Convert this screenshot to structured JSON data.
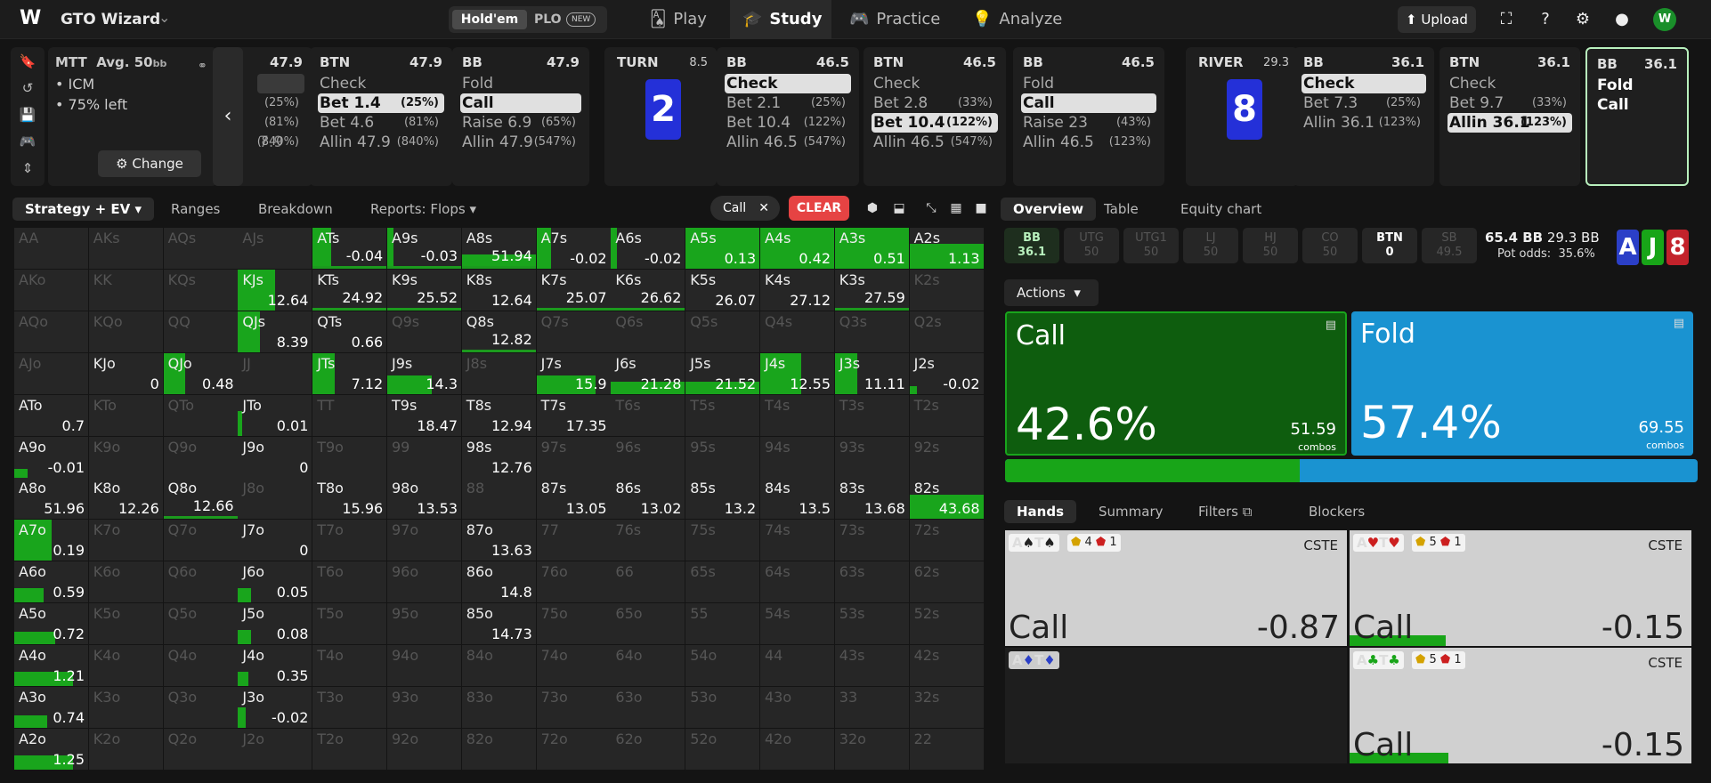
{
  "header": {
    "brand": "GTO Wizard",
    "toggle": {
      "holdem": "Hold'em",
      "plo": "PLO",
      "new_badge": "NEW"
    },
    "nav": [
      {
        "label": "Play",
        "icon": "cards-icon"
      },
      {
        "label": "Study",
        "icon": "graduation-cap-icon"
      },
      {
        "label": "Practice",
        "icon": "gamepad-icon"
      },
      {
        "label": "Analyze",
        "icon": "lightbulb-icon"
      }
    ],
    "upload": "Upload"
  },
  "mtt": {
    "title": "MTT",
    "avg": "Avg. 50",
    "bb": "bb",
    "icm": "• ICM",
    "left": "• 75% left",
    "change": "Change"
  },
  "partial": {
    "stack": "47.9",
    "a1": "(25%)",
    "a2": "(81%)",
    "a3": "(840%)",
    "prefix": "7.9"
  },
  "cards": [
    {
      "pos": "BTN",
      "stack": "47.9",
      "actions": [
        {
          "label": "Check",
          "pct": ""
        },
        {
          "label": "Bet 1.4",
          "pct": "(25%)",
          "chosen": true
        },
        {
          "label": "Bet 4.6",
          "pct": "(81%)"
        },
        {
          "label": "Allin 47.9",
          "pct": "(840%)"
        }
      ]
    },
    {
      "pos": "BB",
      "stack": "47.9",
      "actions": [
        {
          "label": "Fold",
          "pct": ""
        },
        {
          "label": "Call",
          "pct": "",
          "chosen": true
        },
        {
          "label": "Raise 6.9",
          "pct": "(65%)"
        },
        {
          "label": "Allin 47.9",
          "pct": "(547%)"
        }
      ]
    },
    {
      "pos": "BB",
      "stack": "46.5",
      "actions": [
        {
          "label": "Check",
          "pct": "",
          "chosen": true
        },
        {
          "label": "Bet 2.1",
          "pct": "(25%)"
        },
        {
          "label": "Bet 10.4",
          "pct": "(122%)"
        },
        {
          "label": "Allin 46.5",
          "pct": "(547%)"
        }
      ]
    },
    {
      "pos": "BTN",
      "stack": "46.5",
      "actions": [
        {
          "label": "Check",
          "pct": ""
        },
        {
          "label": "Bet 2.8",
          "pct": "(33%)"
        },
        {
          "label": "Bet 10.4",
          "pct": "(122%)",
          "chosen": true
        },
        {
          "label": "Allin 46.5",
          "pct": "(547%)"
        }
      ]
    },
    {
      "pos": "BB",
      "stack": "46.5",
      "actions": [
        {
          "label": "Fold",
          "pct": ""
        },
        {
          "label": "Call",
          "pct": "",
          "chosen": true
        },
        {
          "label": "Raise 23",
          "pct": "(43%)"
        },
        {
          "label": "Allin 46.5",
          "pct": "(123%)"
        }
      ]
    },
    {
      "pos": "BB",
      "stack": "36.1",
      "actions": [
        {
          "label": "Check",
          "pct": "",
          "chosen": true
        },
        {
          "label": "Bet 7.3",
          "pct": "(25%)"
        },
        {
          "label": "Allin 36.1",
          "pct": "(123%)"
        }
      ]
    },
    {
      "pos": "BTN",
      "stack": "36.1",
      "actions": [
        {
          "label": "Check",
          "pct": ""
        },
        {
          "label": "Bet 9.7",
          "pct": "(33%)"
        },
        {
          "label": "Allin 36.1",
          "pct": "(123%)",
          "chosen": true
        }
      ]
    },
    {
      "pos": "BB",
      "stack": "36.1",
      "actions": [
        {
          "label": "Fold",
          "pct": ""
        },
        {
          "label": "Call",
          "pct": ""
        }
      ]
    }
  ],
  "streets": [
    {
      "name": "TURN",
      "pot": "8.5",
      "card": "2"
    },
    {
      "name": "RIVER",
      "pot": "29.3",
      "card": "8"
    }
  ],
  "lefttabs": {
    "strategy": "Strategy + EV",
    "ranges": "Ranges",
    "breakdown": "Breakdown",
    "reports": "Reports: Flops",
    "chip": "Call",
    "clear": "CLEAR"
  },
  "grid": {
    "rows": [
      [
        "AA",
        "AKs",
        "AQs",
        "AJs",
        "ATs",
        "A9s",
        "A8s",
        "A7s",
        "A6s",
        "A5s",
        "A4s",
        "A3s",
        "A2s"
      ],
      [
        "AKo",
        "KK",
        "KQs",
        "KJs",
        "KTs",
        "K9s",
        "K8s",
        "K7s",
        "K6s",
        "K5s",
        "K4s",
        "K3s",
        "K2s"
      ],
      [
        "AQo",
        "KQo",
        "QQ",
        "QJs",
        "QTs",
        "Q9s",
        "Q8s",
        "Q7s",
        "Q6s",
        "Q5s",
        "Q4s",
        "Q3s",
        "Q2s"
      ],
      [
        "AJo",
        "KJo",
        "QJo",
        "JJ",
        "JTs",
        "J9s",
        "J8s",
        "J7s",
        "J6s",
        "J5s",
        "J4s",
        "J3s",
        "J2s"
      ],
      [
        "ATo",
        "KTo",
        "QTo",
        "JTo",
        "TT",
        "T9s",
        "T8s",
        "T7s",
        "T6s",
        "T5s",
        "T4s",
        "T3s",
        "T2s"
      ],
      [
        "A9o",
        "K9o",
        "Q9o",
        "J9o",
        "T9o",
        "99",
        "98s",
        "97s",
        "96s",
        "95s",
        "94s",
        "93s",
        "92s"
      ],
      [
        "A8o",
        "K8o",
        "Q8o",
        "J8o",
        "T8o",
        "98o",
        "88",
        "87s",
        "86s",
        "85s",
        "84s",
        "83s",
        "82s"
      ],
      [
        "A7o",
        "K7o",
        "Q7o",
        "J7o",
        "T7o",
        "97o",
        "87o",
        "77",
        "76s",
        "75s",
        "74s",
        "73s",
        "72s"
      ],
      [
        "A6o",
        "K6o",
        "Q6o",
        "J6o",
        "T6o",
        "96o",
        "86o",
        "76o",
        "66",
        "65s",
        "64s",
        "63s",
        "62s"
      ],
      [
        "A5o",
        "K5o",
        "Q5o",
        "J5o",
        "T5o",
        "95o",
        "85o",
        "75o",
        "65o",
        "55",
        "54s",
        "53s",
        "52s"
      ],
      [
        "A4o",
        "K4o",
        "Q4o",
        "J4o",
        "T4o",
        "94o",
        "84o",
        "74o",
        "64o",
        "54o",
        "44",
        "43s",
        "42s"
      ],
      [
        "A3o",
        "K3o",
        "Q3o",
        "J3o",
        "T3o",
        "93o",
        "83o",
        "73o",
        "63o",
        "53o",
        "43o",
        "33",
        "32s"
      ],
      [
        "A2o",
        "K2o",
        "Q2o",
        "J2o",
        "T2o",
        "92o",
        "82o",
        "72o",
        "62o",
        "52o",
        "42o",
        "32o",
        "22"
      ]
    ],
    "cells": {
      "ATs": {
        "ev": "-0.04",
        "call": 0.25,
        "ul": true
      },
      "A9s": {
        "ev": "-0.03",
        "call": 0.08,
        "ul": true
      },
      "A8s": {
        "ev": "51.94",
        "call": 1,
        "h": 0.3,
        "ul": true
      },
      "A7s": {
        "ev": "-0.02",
        "call": 0.2,
        "h": 1
      },
      "A6s": {
        "ev": "-0.02",
        "call": 0.08,
        "h": 1
      },
      "A5s": {
        "ev": "0.13",
        "call": 1,
        "h": 1
      },
      "A4s": {
        "ev": "0.42",
        "call": 1,
        "h": 1
      },
      "A3s": {
        "ev": "0.51",
        "call": 1,
        "h": 1
      },
      "A2s": {
        "ev": "1.13",
        "call": 1,
        "h": 0.6
      },
      "KJs": {
        "ev": "12.64",
        "call": 0.5,
        "h": 1
      },
      "KTs": {
        "ev": "24.92",
        "ul": true
      },
      "K9s": {
        "ev": "25.52",
        "ul": true
      },
      "K8s": {
        "ev": "12.64"
      },
      "K7s": {
        "ev": "25.07",
        "ul": true
      },
      "K6s": {
        "ev": "26.62",
        "ul": true
      },
      "K5s": {
        "ev": "26.07"
      },
      "K4s": {
        "ev": "27.12"
      },
      "K3s": {
        "ev": "27.59",
        "ul": true
      },
      "QJs": {
        "ev": "8.39",
        "call": 0.3,
        "h": 1
      },
      "QTs": {
        "ev": "0.66"
      },
      "Q8s": {
        "ev": "12.82",
        "ul": true
      },
      "KJo": {
        "ev": "0"
      },
      "QJo": {
        "ev": "0.48",
        "call": 0.3,
        "h": 1
      },
      "JTs": {
        "ev": "7.12",
        "call": 0.3,
        "h": 1
      },
      "J9s": {
        "ev": "14.3",
        "call": 0.6,
        "h": 0.45
      },
      "J7s": {
        "ev": "15.9",
        "call": 0.8,
        "h": 0.45
      },
      "J6s": {
        "ev": "21.28",
        "call": 1,
        "h": 0.3
      },
      "J5s": {
        "ev": "21.52",
        "call": 1,
        "h": 0.3
      },
      "J4s": {
        "ev": "12.55",
        "call": 0.55,
        "h": 1
      },
      "J3s": {
        "ev": "11.11",
        "call": 0.3,
        "h": 1
      },
      "J2s": {
        "ev": "-0.02",
        "call": 0.1,
        "h": 0.2
      },
      "ATo": {
        "ev": "0.7"
      },
      "JTo": {
        "ev": "0.01",
        "call": 0.05,
        "h": 0.6
      },
      "T9s": {
        "ev": "18.47"
      },
      "T8s": {
        "ev": "12.94"
      },
      "T7s": {
        "ev": "17.35"
      },
      "A9o": {
        "ev": "-0.01",
        "call": 0.18,
        "h": 0.2
      },
      "J9o": {
        "ev": "0"
      },
      "98s": {
        "ev": "12.76"
      },
      "A8o": {
        "ev": "51.96"
      },
      "K8o": {
        "ev": "12.26"
      },
      "Q8o": {
        "ev": "12.66",
        "ul": true
      },
      "T8o": {
        "ev": "15.96"
      },
      "98o": {
        "ev": "13.53"
      },
      "87s": {
        "ev": "13.05"
      },
      "86s": {
        "ev": "13.02"
      },
      "85s": {
        "ev": "13.2"
      },
      "84s": {
        "ev": "13.5"
      },
      "83s": {
        "ev": "13.68"
      },
      "82s": {
        "ev": "43.68",
        "call": 1,
        "h": 0.6
      },
      "A7o": {
        "ev": "0.19",
        "call": 0.5,
        "h": 1
      },
      "J7o": {
        "ev": "0"
      },
      "87o": {
        "ev": "13.63"
      },
      "A6o": {
        "ev": "0.59",
        "call": 0.4,
        "h": 0.35
      },
      "J6o": {
        "ev": "0.05",
        "call": 0.18,
        "h": 0.35
      },
      "86o": {
        "ev": "14.8"
      },
      "A5o": {
        "ev": "0.72",
        "call": 0.55,
        "h": 0.3
      },
      "J5o": {
        "ev": "0.08",
        "call": 0.18,
        "h": 0.35
      },
      "85o": {
        "ev": "14.73"
      },
      "A4o": {
        "ev": "1.21",
        "call": 0.8,
        "h": 0.35
      },
      "J4o": {
        "ev": "0.35",
        "call": 0.14,
        "h": 0.35
      },
      "A3o": {
        "ev": "0.74",
        "call": 0.45,
        "h": 0.3
      },
      "J3o": {
        "ev": "-0.02",
        "call": 0.1,
        "h": 0.5
      },
      "A2o": {
        "ev": "1.25",
        "call": 0.8,
        "h": 0.35
      }
    }
  },
  "righttabs": {
    "overview": "Overview",
    "table": "Table",
    "equity": "Equity chart"
  },
  "positions": [
    {
      "name": "BB",
      "stack": "36.1"
    },
    {
      "name": "UTG",
      "stack": "50"
    },
    {
      "name": "UTG1",
      "stack": "50"
    },
    {
      "name": "LJ",
      "stack": "50"
    },
    {
      "name": "HJ",
      "stack": "50"
    },
    {
      "name": "CO",
      "stack": "50"
    },
    {
      "name": "BTN",
      "stack": "0"
    },
    {
      "name": "SB",
      "stack": "49.5"
    }
  ],
  "pot": {
    "main": "65.4 BB",
    "side": "29.3 BB",
    "odds_label": "Pot odds:",
    "odds": "35.6%"
  },
  "board": [
    {
      "rank": "A",
      "color": "#2b3fc7"
    },
    {
      "rank": "J",
      "color": "#18a518"
    },
    {
      "rank": "8",
      "color": "#c3222b"
    }
  ],
  "actions_dd": "Actions",
  "summary": [
    {
      "name": "Call",
      "pct": "42.6%",
      "combos": "51.59",
      "combos_label": "combos",
      "color": "#0e5d0e"
    },
    {
      "name": "Fold",
      "pct": "57.4%",
      "combos": "69.55",
      "combos_label": "combos",
      "color": "#1a93d1"
    }
  ],
  "call_share": 0.426,
  "handtabs": {
    "hands": "Hands",
    "summary": "Summary",
    "filters": "Filters",
    "blockers": "Blockers"
  },
  "hands": [
    {
      "h1": "A",
      "s1": "♠",
      "h2": "T",
      "s2": "♠",
      "suit_color": "#222",
      "b1": "4",
      "b2": "1",
      "cste": "CSTE",
      "action": "Call",
      "ev": "-0.87",
      "fill": 0
    },
    {
      "h1": "A",
      "s1": "♥",
      "h2": "T",
      "s2": "♥",
      "suit_color": "#cc1f1f",
      "b1": "5",
      "b2": "1",
      "cste": "CSTE",
      "action": "Call",
      "ev": "-0.15",
      "fill": 0.28
    },
    {
      "h1": "A",
      "s1": "♦",
      "h2": "T",
      "s2": "♦",
      "suit_color": "#2b3fc7",
      "empty": true
    },
    {
      "h1": "A",
      "s1": "♣",
      "h2": "T",
      "s2": "♣",
      "suit_color": "#18a518",
      "b1": "5",
      "b2": "1",
      "cste": "CSTE",
      "action": "Call",
      "ev": "-0.15",
      "fill": 0.29
    }
  ]
}
